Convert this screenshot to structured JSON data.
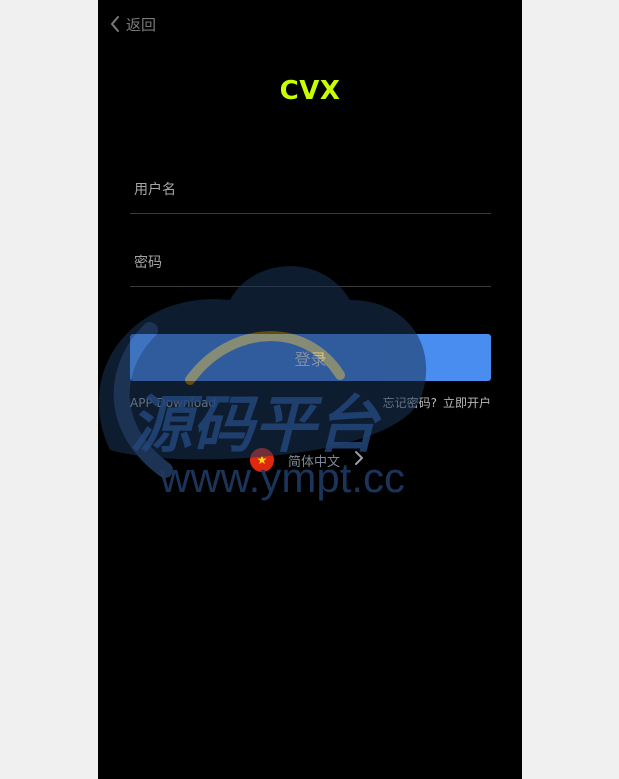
{
  "header": {
    "back_label": "返回"
  },
  "app": {
    "title": "CVX"
  },
  "form": {
    "username_placeholder": "用户名",
    "password_placeholder": "密码",
    "username_value": "",
    "password_value": "",
    "login_label": "登录"
  },
  "links": {
    "app_download": "APP Download",
    "forgot_password": "忘记密码?",
    "register": "立即开户"
  },
  "language": {
    "label": "简体中文",
    "flag_icon": "china-flag-icon",
    "chevron_icon": "chevron-right-icon"
  },
  "watermark": {
    "title": "源码平台",
    "url": "www.ympt.cc"
  },
  "colors": {
    "page_bg": "#f0f0f0",
    "screen_bg": "#000000",
    "title_accent": "#c8ff00",
    "primary_button": "#4a8df0",
    "muted_text": "#b8b8b8"
  }
}
